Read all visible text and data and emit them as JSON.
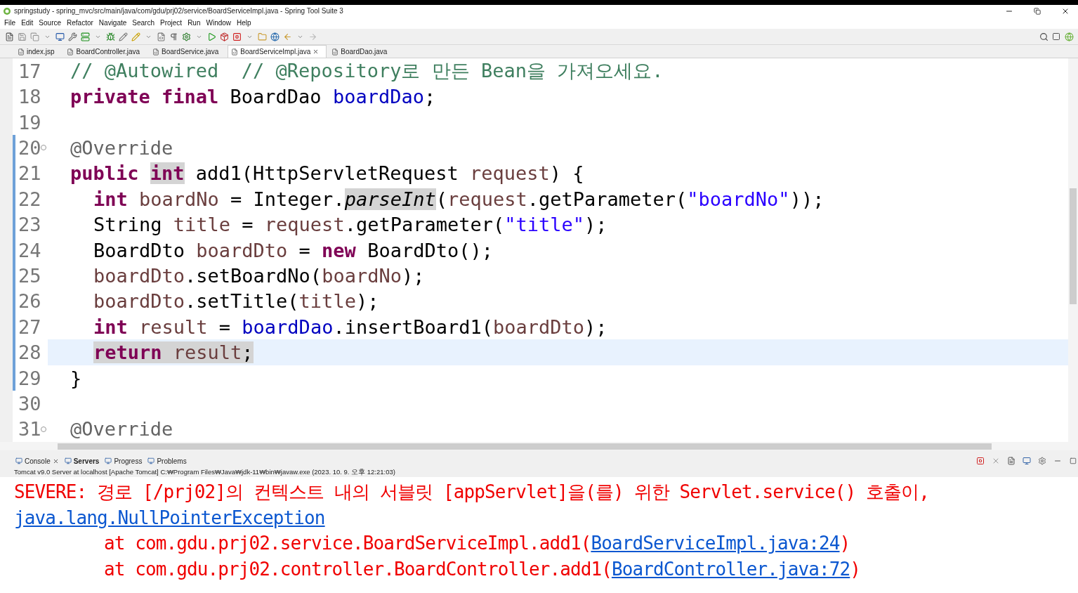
{
  "window": {
    "title": "springstudy - spring_mvc/src/main/java/com/gdu/prj02/service/BoardServiceImpl.java - Spring Tool Suite 3"
  },
  "menu": [
    "File",
    "Edit",
    "Source",
    "Refactor",
    "Navigate",
    "Search",
    "Project",
    "Run",
    "Window",
    "Help"
  ],
  "editor_tabs": [
    {
      "label": "index.jsp",
      "selected": false
    },
    {
      "label": "BoardController.java",
      "selected": false
    },
    {
      "label": "BoardService.java",
      "selected": false
    },
    {
      "label": "BoardServiceImpl.java",
      "selected": true
    },
    {
      "label": "BoardDao.java",
      "selected": false
    }
  ],
  "editor": {
    "lines": [
      {
        "number": "17",
        "changed": false,
        "current": false,
        "foldable": false,
        "indent": false,
        "tokens": [
          {
            "t": "// @Autowired  // @Repository로 만든 Bean을 가져오세요.",
            "kind": "comment"
          }
        ]
      },
      {
        "number": "18",
        "changed": false,
        "current": false,
        "foldable": false,
        "indent": false,
        "tokens": [
          {
            "t": "private final",
            "kind": "keyword"
          },
          {
            "t": "BoardDao",
            "kind": "plain",
            "sp": true
          },
          {
            "t": "boardDao",
            "kind": "field",
            "sp": true
          },
          {
            "t": ";",
            "kind": "plain"
          }
        ]
      },
      {
        "number": "19",
        "changed": false,
        "current": false,
        "foldable": false
      },
      {
        "number": "20",
        "changed": true,
        "current": false,
        "foldable": true,
        "indent": false,
        "tokens": [
          {
            "t": "@Override",
            "kind": "annotation"
          }
        ]
      },
      {
        "number": "21",
        "changed": true,
        "current": false,
        "foldable": false,
        "indent": false,
        "tokens": [
          {
            "t": "public",
            "kind": "keyword"
          },
          {
            "t": "int",
            "kind": "keyword",
            "sp": true,
            "highlighted": true
          },
          {
            "t": "add1(HttpServletRequest",
            "kind": "plain",
            "sp": true
          },
          {
            "t": "request",
            "kind": "local",
            "sp": true
          },
          {
            "t": ") {",
            "kind": "plain"
          }
        ]
      },
      {
        "number": "22",
        "changed": true,
        "current": false,
        "foldable": false,
        "indent": true,
        "tokens": [
          {
            "t": "int",
            "kind": "keyword"
          },
          {
            "t": "boardNo",
            "kind": "local",
            "sp": true
          },
          {
            "t": "= Integer.",
            "kind": "plain",
            "sp": true
          },
          {
            "t": "parseInt",
            "kind": "static",
            "highlighted": true
          },
          {
            "t": "(",
            "kind": "plain"
          },
          {
            "t": "request",
            "kind": "local"
          },
          {
            "t": ".getParameter(",
            "kind": "plain"
          },
          {
            "t": "\"boardNo\"",
            "kind": "string"
          },
          {
            "t": "));",
            "kind": "plain"
          }
        ]
      },
      {
        "number": "23",
        "changed": true,
        "current": false,
        "foldable": false,
        "indent": true,
        "tokens": [
          {
            "t": "String",
            "kind": "plain"
          },
          {
            "t": "title",
            "kind": "local",
            "sp": true
          },
          {
            "t": "=",
            "kind": "plain",
            "sp": true
          },
          {
            "t": "request",
            "kind": "local",
            "sp": true
          },
          {
            "t": ".getParameter(",
            "kind": "plain"
          },
          {
            "t": "\"title\"",
            "kind": "string"
          },
          {
            "t": ");",
            "kind": "plain"
          }
        ]
      },
      {
        "number": "24",
        "changed": true,
        "current": false,
        "foldable": false,
        "indent": true,
        "tokens": [
          {
            "t": "BoardDto",
            "kind": "plain"
          },
          {
            "t": "boardDto",
            "kind": "local",
            "sp": true
          },
          {
            "t": "=",
            "kind": "plain",
            "sp": true
          },
          {
            "t": "new",
            "kind": "keyword",
            "sp": true
          },
          {
            "t": "BoardDto();",
            "kind": "plain",
            "sp": true
          }
        ]
      },
      {
        "number": "25",
        "changed": true,
        "current": false,
        "foldable": false,
        "indent": true,
        "tokens": [
          {
            "t": "boardDto",
            "kind": "local"
          },
          {
            "t": ".setBoardNo(",
            "kind": "plain"
          },
          {
            "t": "boardNo",
            "kind": "local"
          },
          {
            "t": ");",
            "kind": "plain"
          }
        ]
      },
      {
        "number": "26",
        "changed": true,
        "current": false,
        "foldable": false,
        "indent": true,
        "tokens": [
          {
            "t": "boardDto",
            "kind": "local"
          },
          {
            "t": ".setTitle(",
            "kind": "plain"
          },
          {
            "t": "title",
            "kind": "local"
          },
          {
            "t": ");",
            "kind": "plain"
          }
        ]
      },
      {
        "number": "27",
        "changed": true,
        "current": false,
        "foldable": false,
        "indent": true,
        "tokens": [
          {
            "t": "int",
            "kind": "keyword"
          },
          {
            "t": "result",
            "kind": "local",
            "sp": true
          },
          {
            "t": "=",
            "kind": "plain",
            "sp": true
          },
          {
            "t": "boardDao",
            "kind": "field",
            "sp": true
          },
          {
            "t": ".insertBoard1(",
            "kind": "plain"
          },
          {
            "t": "boardDto",
            "kind": "local"
          },
          {
            "t": ");",
            "kind": "plain"
          }
        ]
      },
      {
        "number": "28",
        "changed": true,
        "current": true,
        "foldable": false,
        "indent": true,
        "tokens": [
          {
            "t": "return",
            "kind": "keyword",
            "highlighted": true
          },
          {
            "t": "result",
            "kind": "local",
            "sp": true,
            "highlighted": true
          },
          {
            "t": ";",
            "kind": "plain",
            "highlighted": true
          }
        ]
      },
      {
        "number": "29",
        "changed": true,
        "current": false,
        "foldable": false,
        "indent": false,
        "tokens": [
          {
            "t": "}",
            "kind": "plain"
          }
        ]
      },
      {
        "number": "30",
        "changed": false,
        "current": false,
        "foldable": false
      },
      {
        "number": "31",
        "changed": false,
        "current": false,
        "foldable": true,
        "indent": false,
        "tokens": [
          {
            "t": "@Override",
            "kind": "annotation"
          }
        ]
      }
    ]
  },
  "console_tabs": [
    {
      "label": "Console",
      "selected": false,
      "closable": true
    },
    {
      "label": "Servers",
      "selected": true,
      "closable": false
    },
    {
      "label": "Progress",
      "selected": false,
      "closable": false
    },
    {
      "label": "Problems",
      "selected": false,
      "closable": false
    }
  ],
  "console": {
    "header": "Tomcat v9.0 Server at localhost [Apache Tomcat] C:₩Program Files₩Java₩jdk-11₩bin₩javaw.exe  (2023. 10. 9. 오후 12:21:03)",
    "lines": [
      {
        "indent": false,
        "parts": [
          {
            "t": "SEVERE: 경로 [/prj02]의 컨텍스트 내의 서블릿 [appServlet]을(를) 위한 Servlet.service() 호출이,",
            "link": false
          }
        ]
      },
      {
        "indent": false,
        "parts": [
          {
            "t": "java.lang.NullPointerException",
            "link": true
          }
        ]
      },
      {
        "indent": true,
        "parts": [
          {
            "t": "at com.gdu.prj02.service.BoardServiceImpl.add1(",
            "link": false
          },
          {
            "t": "BoardServiceImpl.java:24",
            "link": true
          },
          {
            "t": ")",
            "link": false
          }
        ]
      },
      {
        "indent": true,
        "parts": [
          {
            "t": "at com.gdu.prj02.controller.BoardController.add1(",
            "link": false
          },
          {
            "t": "BoardController.java:72",
            "link": true
          },
          {
            "t": ")",
            "link": false
          }
        ]
      }
    ]
  }
}
